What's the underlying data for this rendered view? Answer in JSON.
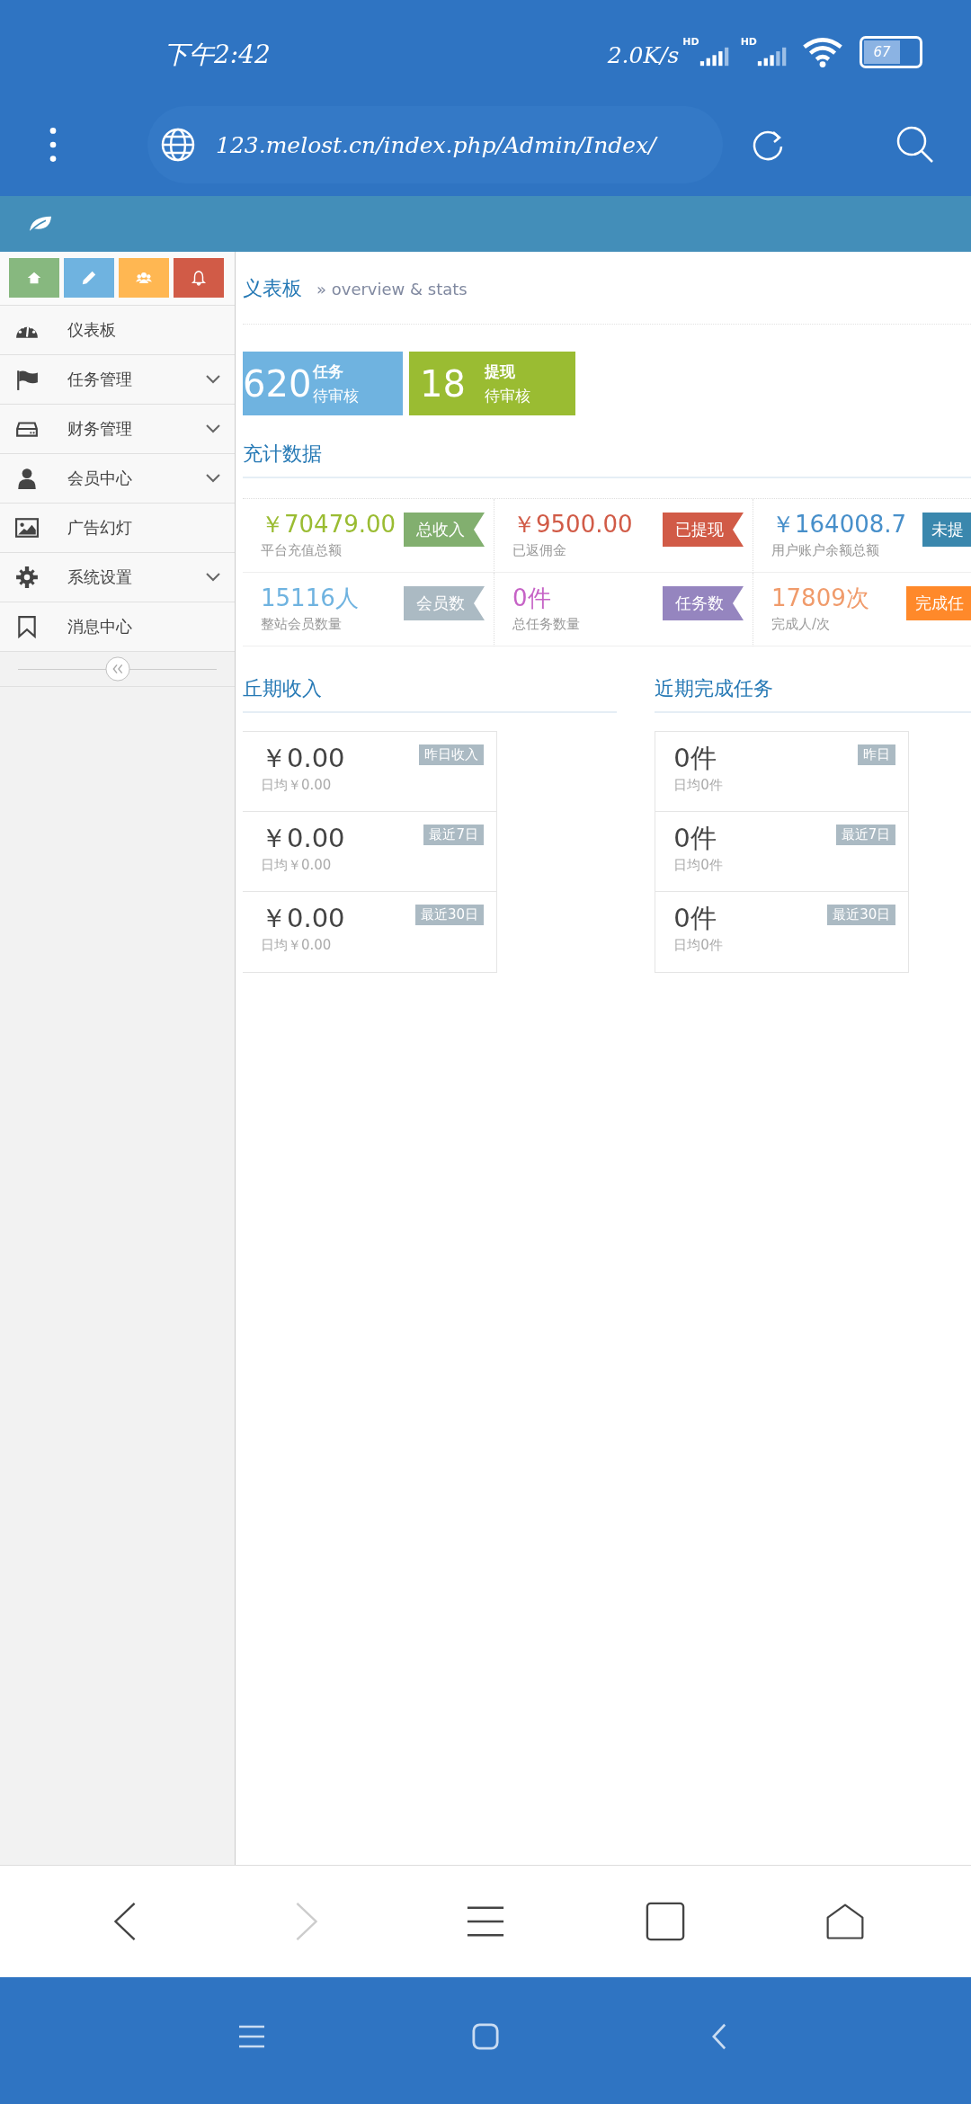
{
  "status_bar": {
    "time": "下午2:42",
    "network_speed": "2.0K/s",
    "sim_labels": [
      "HD",
      "HD"
    ],
    "battery": "67"
  },
  "browser": {
    "url": "123.melost.cn/index.php/Admin/Index/"
  },
  "sidebar": {
    "shortcuts": [
      {
        "kind": "home",
        "color": "#87b87f"
      },
      {
        "kind": "edit",
        "color": "#6fb3e0"
      },
      {
        "kind": "users",
        "color": "#ffb752"
      },
      {
        "kind": "bell",
        "color": "#d15b47"
      }
    ],
    "items": [
      {
        "kind": "dashboard",
        "label": "仪表板",
        "expandable": false
      },
      {
        "kind": "flag",
        "label": "任务管理",
        "expandable": true
      },
      {
        "kind": "drive",
        "label": "财务管理",
        "expandable": true
      },
      {
        "kind": "user",
        "label": "会员中心",
        "expandable": true
      },
      {
        "kind": "image",
        "label": "广告幻灯",
        "expandable": false
      },
      {
        "kind": "gear",
        "label": "系统设置",
        "expandable": true
      },
      {
        "kind": "bookmark",
        "label": "消息中心",
        "expandable": false
      }
    ]
  },
  "page_header": {
    "title": "义表板",
    "subtitle": "» overview & stats"
  },
  "pending_tiles": [
    {
      "count": "620",
      "title": "任务",
      "subtitle": "待审核",
      "color": "#6fb3e0"
    },
    {
      "count": "18",
      "title": "提现",
      "subtitle": "待审核",
      "color": "#9abc32"
    }
  ],
  "stats_title": "充计数据",
  "stats": [
    {
      "value": {
        "text": "￥70479.00",
        "color": "#9abc32"
      },
      "label": "平台充值总额",
      "badge": {
        "text": "总收入",
        "color": "#82af6f"
      }
    },
    {
      "value": {
        "text": "￥9500.00",
        "color": "#d15b47"
      },
      "label": "已返佣金",
      "badge": {
        "text": "已提现",
        "color": "#d15b47"
      }
    },
    {
      "value": {
        "text": "￥164008.7",
        "color": "#478fca"
      },
      "label": "用户账户余额总额",
      "badge": {
        "text": "未提",
        "color": "#3a87ad"
      }
    },
    {
      "value": {
        "text": "15116人",
        "color": "#6fb3e0"
      },
      "label": "整站会员数量",
      "badge": {
        "text": "会员数",
        "color": "#abbac3"
      }
    },
    {
      "value": {
        "text": "0件",
        "color": "#c663c6"
      },
      "label": "总任务数量",
      "badge": {
        "text": "任务数",
        "color": "#9585bf"
      }
    },
    {
      "value": {
        "text": "17809次",
        "color": "#f09b6b"
      },
      "label": "完成人/次",
      "badge": {
        "text": "完成任",
        "color": "#ff892a"
      }
    }
  ],
  "recent": [
    {
      "title": "丘期收入",
      "rows": [
        {
          "value": "￥0.00",
          "average": "日均￥0.00",
          "badge": "昨日收入"
        },
        {
          "value": "￥0.00",
          "average": "日均￥0.00",
          "badge": "最近7日"
        },
        {
          "value": "￥0.00",
          "average": "日均￥0.00",
          "badge": "最近30日"
        }
      ]
    },
    {
      "title": "近期完成任务",
      "rows": [
        {
          "value": "0件",
          "average": "日均0件",
          "badge": "昨日"
        },
        {
          "value": "0件",
          "average": "日均0件",
          "badge": "最近7日"
        },
        {
          "value": "0件",
          "average": "日均0件",
          "badge": "最近30日"
        }
      ]
    }
  ]
}
